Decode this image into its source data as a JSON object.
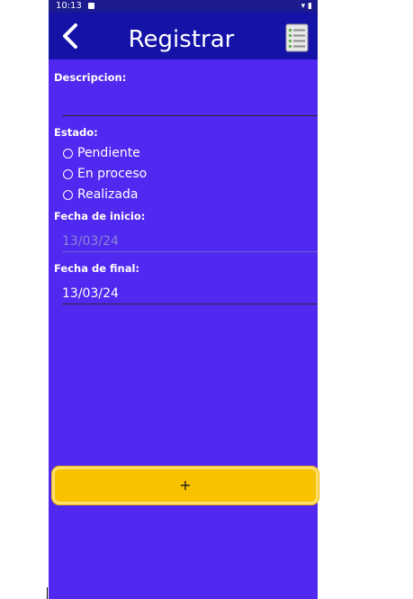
{
  "status_bar": {
    "time": "10:13",
    "right_icons": "▾ ▮"
  },
  "app_bar": {
    "title": "Registrar",
    "back_icon": "chevron-left",
    "menu_icon": "checklist-document"
  },
  "form": {
    "descripcion_label": "Descripcion:",
    "descripcion_value": "",
    "estado_label": "Estado:",
    "estado_options": [
      "Pendiente",
      "En proceso",
      "Realizada"
    ],
    "fecha_inicio_label": "Fecha de inicio:",
    "fecha_inicio_value": "13/03/24",
    "fecha_final_label": "Fecha de final:",
    "fecha_final_value": "13/03/24"
  },
  "add_button": {
    "label": "+"
  },
  "colors": {
    "background": "#5128ef",
    "app_bar": "#1512a8",
    "button": "#f9c200"
  }
}
